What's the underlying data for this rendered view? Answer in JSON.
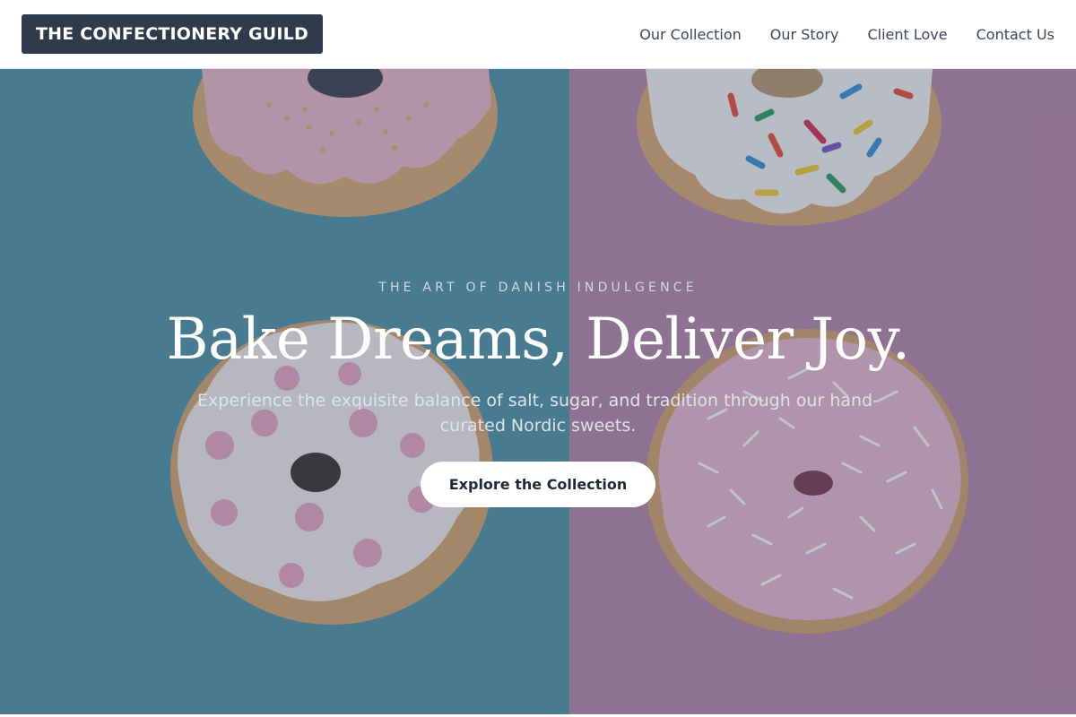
{
  "header": {
    "brand": "THE CONFECTIONERY GUILD",
    "nav": [
      "Our Collection",
      "Our Story",
      "Client Love",
      "Contact Us"
    ]
  },
  "hero": {
    "eyebrow": "THE ART OF DANISH INDULGENCE",
    "headline": "Bake Dreams, Deliver Joy.",
    "subhead": "Experience the exquisite balance of salt, sugar, and tradition through our hand-curated Nordic sweets.",
    "cta": "Explore the Collection",
    "background_colors": {
      "left": "#4f94a8",
      "right": "#b686ad"
    }
  }
}
